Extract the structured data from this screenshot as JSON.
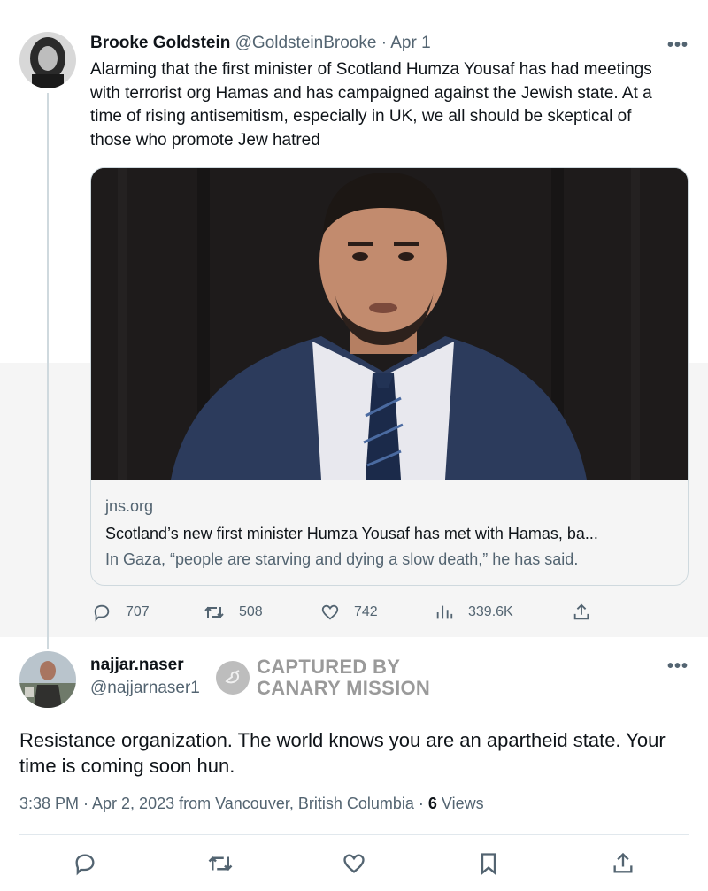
{
  "parent_tweet": {
    "author_name": "Brooke Goldstein",
    "author_handle": "@GoldsteinBrooke",
    "separator": "·",
    "date": "Apr 1",
    "more": "•••",
    "text": "Alarming that the first minister of Scotland Humza Yousaf has had meetings with terrorist org Hamas and has campaigned against the Jewish state. At a time of rising antisemitism, especially in UK, we all should be skeptical of those who promote Jew hatred",
    "card": {
      "domain": "jns.org",
      "title": "Scotland’s new first minister Humza Yousaf has met with Hamas, ba...",
      "description": "In Gaza, “people are starving and dying a slow death,” he has said."
    },
    "actions": {
      "replies": "707",
      "retweets": "508",
      "likes": "742",
      "views": "339.6K"
    }
  },
  "reply_tweet": {
    "author_name": "najjar.naser",
    "author_handle": "@najjarnaser1",
    "more": "•••",
    "text": "Resistance organization. The world knows you are an apartheid state. Your time is coming soon hun.",
    "time": "3:38 PM · Apr 2, 2023 from Vancouver, British Columbia · ",
    "views_count": "6",
    "views_label": " Views"
  },
  "watermark": {
    "line1": "CAPTURED BY",
    "line2": "CANARY MISSION"
  },
  "icons": {
    "reply": "speech-bubble",
    "retweet": "retweet-arrows",
    "like": "heart",
    "views": "bar-chart",
    "share": "upload-arrow",
    "bookmark": "bookmark"
  },
  "colors": {
    "text": "#0f1419",
    "muted": "#536471",
    "border": "#cfd9de",
    "card_bg": "#f5f5f5"
  }
}
